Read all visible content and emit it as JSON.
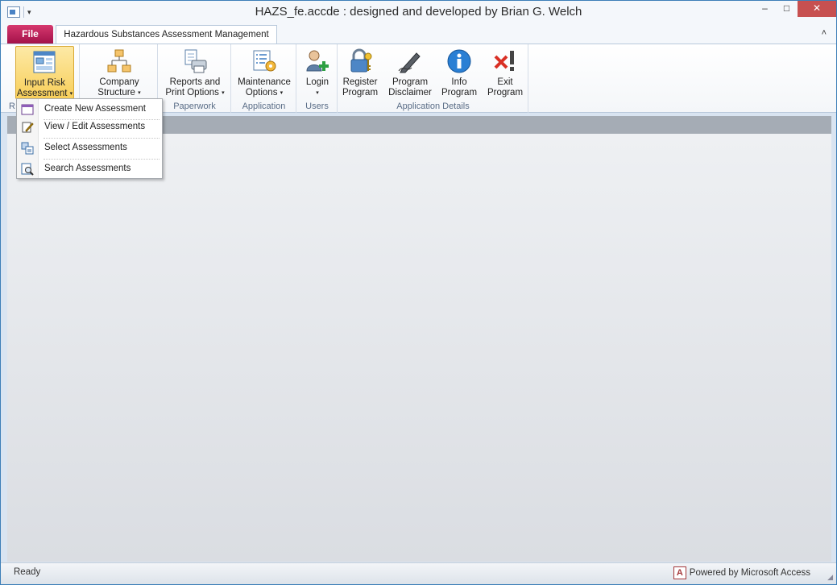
{
  "window": {
    "title": "HAZS_fe.accde : designed and developed by Brian G. Welch",
    "controls": {
      "minimize": "–",
      "maximize": "□",
      "close": "✕"
    }
  },
  "quick_access": {
    "customize_arrow": "▾"
  },
  "tabs": {
    "file": "File",
    "main": "Hazardous Substances Assessment Management",
    "collapse": "˄"
  },
  "ribbon": {
    "groups": [
      {
        "label": "R",
        "buttons": [
          {
            "line1": "Input Risk",
            "line2": "Assessment",
            "caret": "▾",
            "icon": "risk-assessment-icon"
          }
        ]
      },
      {
        "label": "",
        "buttons": [
          {
            "line1": "Company",
            "line2": "Structure",
            "caret": "▾",
            "icon": "org-chart-icon"
          }
        ]
      },
      {
        "label": "Paperwork",
        "buttons": [
          {
            "line1": "Reports and",
            "line2": "Print Options",
            "caret": "▾",
            "icon": "printer-icon"
          }
        ]
      },
      {
        "label": "Application",
        "buttons": [
          {
            "line1": "Maintenance",
            "line2": "Options",
            "caret": "▾",
            "icon": "maintenance-icon"
          }
        ]
      },
      {
        "label": "Users",
        "buttons": [
          {
            "line1": "Login",
            "line2": "",
            "caret": "▾",
            "icon": "user-add-icon"
          }
        ]
      },
      {
        "label": "Application Details",
        "buttons": [
          {
            "line1": "Register",
            "line2": "Program",
            "icon": "lock-key-icon"
          },
          {
            "line1": "Program",
            "line2": "Disclaimer",
            "icon": "pen-signature-icon"
          },
          {
            "line1": "Info",
            "line2": "Program",
            "icon": "info-icon"
          },
          {
            "line1": "Exit",
            "line2": "Program",
            "icon": "exit-icon"
          }
        ]
      }
    ]
  },
  "dropdown": {
    "items": [
      {
        "label": "Create New Assessment",
        "icon": "new-form-icon"
      },
      {
        "label": "View / Edit Assessments",
        "icon": "edit-form-icon"
      },
      {
        "label": "Select Assessments",
        "icon": "select-records-icon"
      },
      {
        "label": "Search Assessments",
        "icon": "search-form-icon"
      }
    ]
  },
  "status": {
    "text": "Ready",
    "powered_by": "Powered by Microsoft Access",
    "access_logo": "A"
  }
}
